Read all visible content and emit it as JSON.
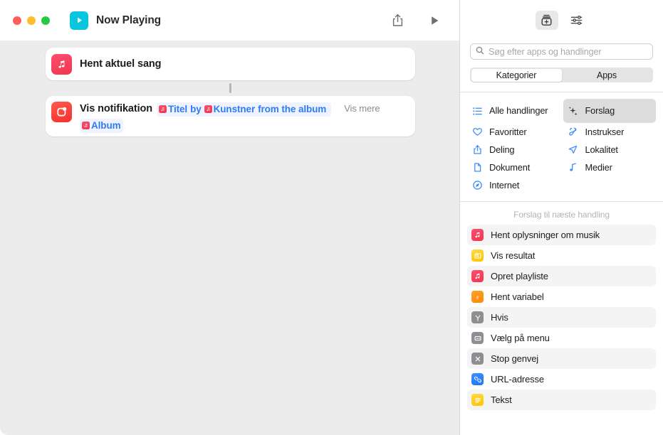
{
  "window": {
    "title": "Now Playing",
    "app_icon": "play-icon",
    "traffic_lights": [
      "close-button",
      "minimize-button",
      "zoom-button"
    ]
  },
  "toolbar": {
    "share_label": "share-icon",
    "run_label": "play-icon"
  },
  "library_toolbar": {
    "action_library_icon": "action-library-icon",
    "settings_icon": "sliders-icon"
  },
  "workflow": {
    "actions": [
      {
        "icon": "music-note-icon",
        "title": "Hent aktuel sang"
      },
      {
        "icon": "notification-icon",
        "title": "Vis notifikation",
        "show_more": "Vis mere",
        "params_line1": [
          {
            "type": "token",
            "icon": "music-note-icon",
            "label": "Titel"
          },
          {
            "type": "word",
            "label": "by"
          },
          {
            "type": "token",
            "icon": "music-note-icon",
            "label": "Kunstner"
          },
          {
            "type": "word",
            "label": "from the album"
          }
        ],
        "params_line2": [
          {
            "type": "token",
            "icon": "music-note-icon",
            "label": "Album"
          }
        ]
      }
    ]
  },
  "search": {
    "placeholder": "Søg efter apps og handlinger",
    "value": "",
    "icon": "search-icon"
  },
  "segmented": {
    "options": [
      {
        "label": "Kategorier",
        "selected": true
      },
      {
        "label": "Apps",
        "selected": false
      }
    ]
  },
  "categories": [
    {
      "label": "Alle handlinger",
      "icon": "list-icon",
      "selected": false,
      "tall": true
    },
    {
      "label": "Forslag",
      "icon": "sparkles-icon",
      "selected": true,
      "tall": true
    },
    {
      "label": "Favoritter",
      "icon": "heart-icon",
      "selected": false,
      "tall": false
    },
    {
      "label": "Instrukser",
      "icon": "ribbon-icon",
      "selected": false,
      "tall": false
    },
    {
      "label": "Deling",
      "icon": "share-icon",
      "selected": false,
      "tall": false
    },
    {
      "label": "Lokalitet",
      "icon": "location-icon",
      "selected": false,
      "tall": false
    },
    {
      "label": "Dokument",
      "icon": "document-icon",
      "selected": false,
      "tall": false
    },
    {
      "label": "Medier",
      "icon": "music-icon",
      "selected": false,
      "tall": false
    },
    {
      "label": "Internet",
      "icon": "compass-icon",
      "selected": false,
      "tall": false
    }
  ],
  "suggestions": {
    "header": "Forslag til næste handling",
    "items": [
      {
        "label": "Hent oplysninger om musik",
        "icon": "music-note-icon",
        "color": "ic-music",
        "zebra": true
      },
      {
        "label": "Vis resultat",
        "icon": "quicklook-icon",
        "color": "ic-yellow",
        "zebra": false
      },
      {
        "label": "Opret playliste",
        "icon": "music-note-icon",
        "color": "ic-music",
        "zebra": true
      },
      {
        "label": "Hent variabel",
        "icon": "variable-icon",
        "color": "ic-orange",
        "zebra": false
      },
      {
        "label": "Hvis",
        "icon": "branch-icon",
        "color": "ic-gray",
        "zebra": true
      },
      {
        "label": "Vælg på menu",
        "icon": "menu-icon",
        "color": "ic-gray",
        "zebra": false
      },
      {
        "label": "Stop genvej",
        "icon": "stop-icon",
        "color": "ic-gray",
        "zebra": true
      },
      {
        "label": "URL-adresse",
        "icon": "link-icon",
        "color": "ic-blue",
        "zebra": false
      },
      {
        "label": "Tekst",
        "icon": "text-icon",
        "color": "ic-tekst",
        "zebra": true
      }
    ]
  },
  "colors": {
    "accent_blue": "#2d7cf6",
    "music_red": "#f3344f",
    "notify_red": "#f62f30",
    "app_cyan": "#08c6dd",
    "canvas_bg": "#ececec"
  }
}
